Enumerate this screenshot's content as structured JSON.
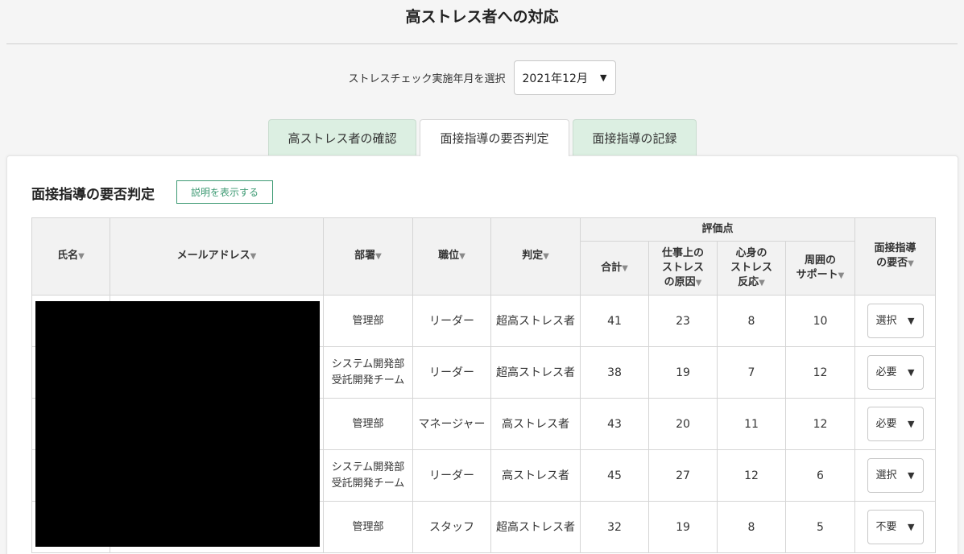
{
  "page": {
    "title": "高ストレス者への対応"
  },
  "period": {
    "label": "ストレスチェック実施年月を選択",
    "selected": "2021年12月"
  },
  "tabs": [
    {
      "label": "高ストレス者の確認",
      "active": false
    },
    {
      "label": "面接指導の要否判定",
      "active": true
    },
    {
      "label": "面接指導の記録",
      "active": false
    }
  ],
  "section": {
    "title": "面接指導の要否判定",
    "explain_label": "説明を表示する"
  },
  "table": {
    "headers": {
      "name": "氏名",
      "email": "メールアドレス",
      "department": "部署",
      "position": "職位",
      "judgment": "判定",
      "score_group": "評価点",
      "total": "合計",
      "work_line1": "仕事上の",
      "work_line2": "ストレス",
      "work_line3": "の原因",
      "mind_line1": "心身の",
      "mind_line2": "ストレス",
      "mind_line3": "反応",
      "support_line1": "周囲の",
      "support_line2": "サポート",
      "decision_line1": "面接指導",
      "decision_line2": "の要否",
      "sort_glyph": "▼"
    },
    "rows": [
      {
        "dept_line1": "管理部",
        "dept_line2": "",
        "position": "リーダー",
        "judgment": "超高ストレス者",
        "total": "41",
        "work": "23",
        "mind": "8",
        "support": "10",
        "decision": "選択"
      },
      {
        "dept_line1": "システム開発部",
        "dept_line2": "受託開発チーム",
        "position": "リーダー",
        "judgment": "超高ストレス者",
        "total": "38",
        "work": "19",
        "mind": "7",
        "support": "12",
        "decision": "必要"
      },
      {
        "dept_line1": "管理部",
        "dept_line2": "",
        "position": "マネージャー",
        "judgment": "高ストレス者",
        "total": "43",
        "work": "20",
        "mind": "11",
        "support": "12",
        "decision": "必要"
      },
      {
        "dept_line1": "システム開発部",
        "dept_line2": "受託開発チーム",
        "position": "リーダー",
        "judgment": "高ストレス者",
        "total": "45",
        "work": "27",
        "mind": "12",
        "support": "6",
        "decision": "選択"
      },
      {
        "dept_line1": "管理部",
        "dept_line2": "",
        "position": "スタッフ",
        "judgment": "超高ストレス者",
        "total": "32",
        "work": "19",
        "mind": "8",
        "support": "5",
        "decision": "不要"
      }
    ]
  },
  "colors": {
    "accent": "#3d9a73",
    "tab_inactive_bg": "#dcefe2",
    "header_bg": "#f2f2f2"
  },
  "icons": {
    "dropdown": "chevron-down-icon",
    "sort": "sort-desc-icon"
  }
}
